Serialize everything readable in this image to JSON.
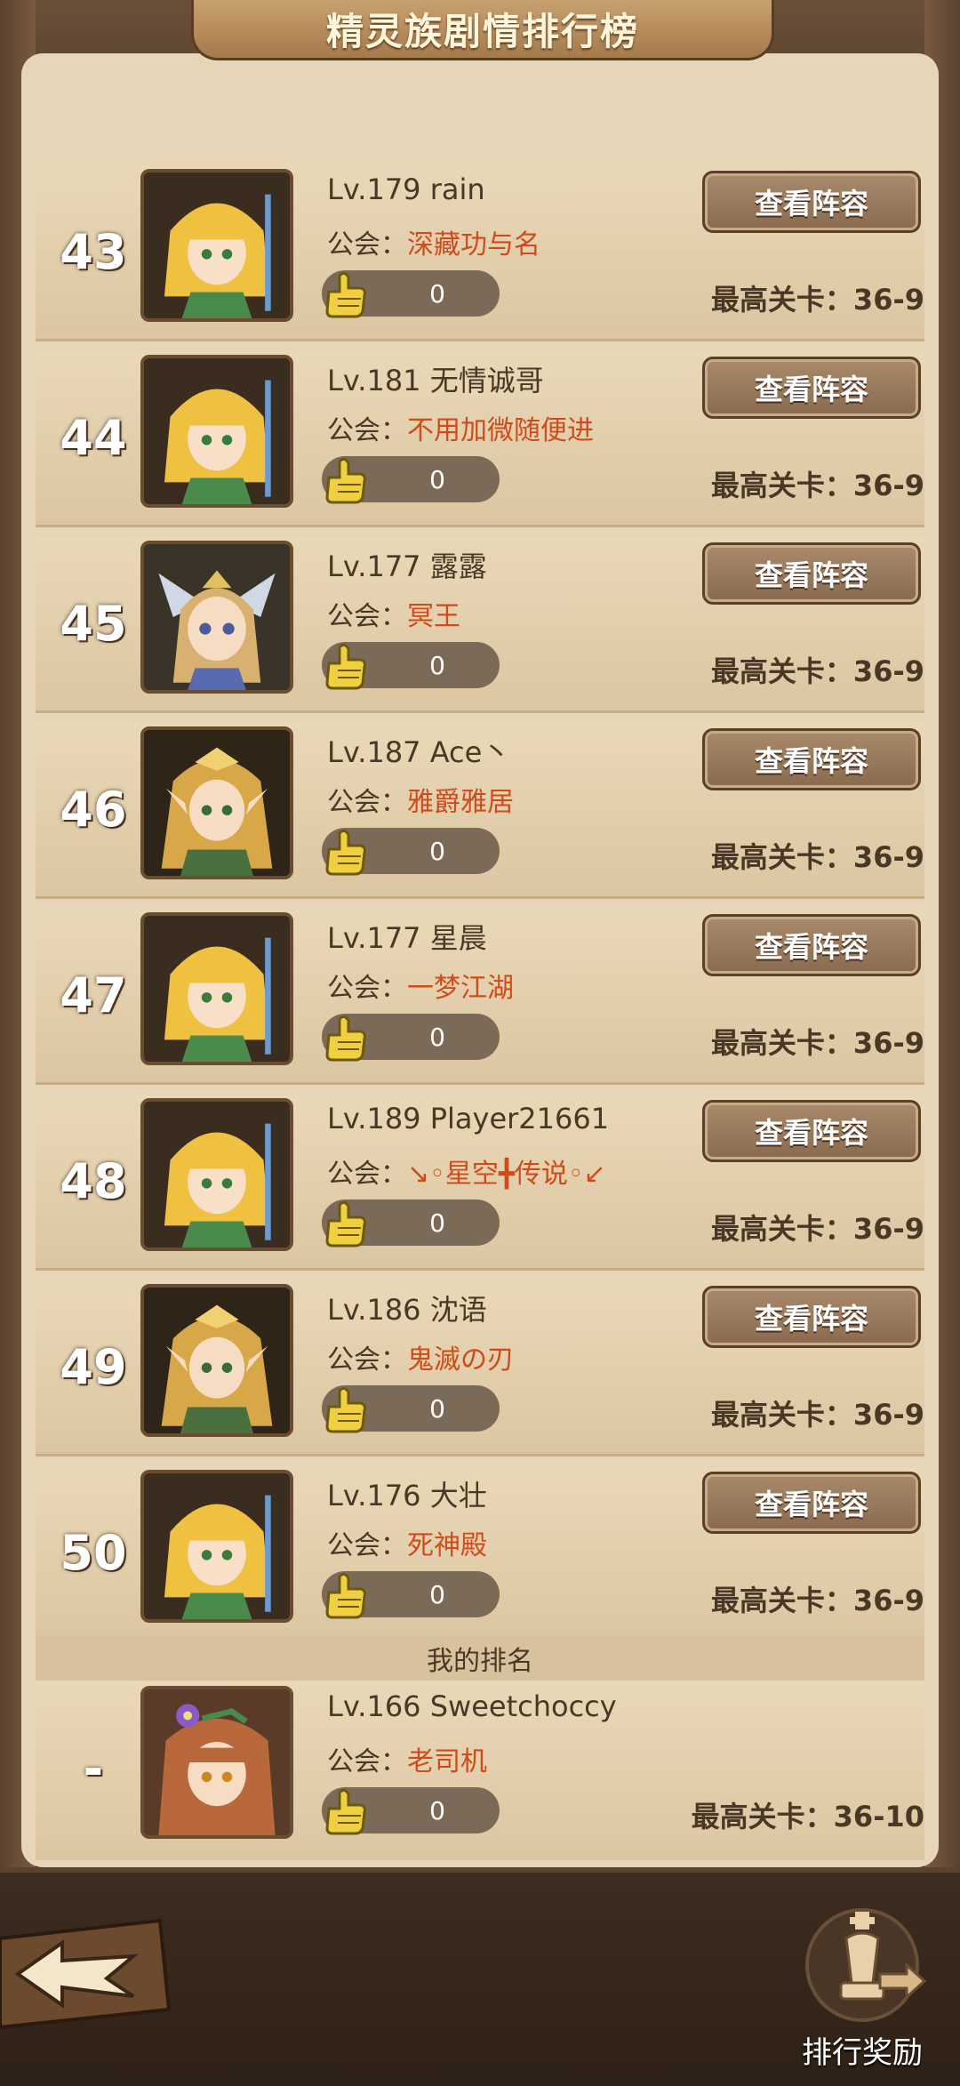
{
  "title": "精灵族剧情排行榜",
  "guild_prefix": "公会：",
  "stage_prefix": "最高关卡：",
  "view_label": "查看阵容",
  "rows": [
    {
      "rank": "43",
      "name": "Lv.179 rain",
      "guild": "深藏功与名",
      "likes": "0",
      "stage": "36-9",
      "avatar": "blonde-mage"
    },
    {
      "rank": "44",
      "name": "Lv.181 无情诚哥",
      "guild": "不用加微随便进",
      "likes": "0",
      "stage": "36-9",
      "avatar": "blonde-mage"
    },
    {
      "rank": "45",
      "name": "Lv.177 露露",
      "guild": "冥王",
      "likes": "0",
      "stage": "36-9",
      "avatar": "winged-knight"
    },
    {
      "rank": "46",
      "name": "Lv.187 Ace丶",
      "guild": "雅爵雅居",
      "likes": "0",
      "stage": "36-9",
      "avatar": "elf-archer"
    },
    {
      "rank": "47",
      "name": "Lv.177 星晨",
      "guild": "一梦江湖",
      "likes": "0",
      "stage": "36-9",
      "avatar": "blonde-mage"
    },
    {
      "rank": "48",
      "name": "Lv.189 Player21661",
      "guild": "↘◦星空╋传说◦↙",
      "likes": "0",
      "stage": "36-9",
      "avatar": "blonde-mage"
    },
    {
      "rank": "49",
      "name": "Lv.186 沈语",
      "guild": "鬼滅の刃",
      "likes": "0",
      "stage": "36-9",
      "avatar": "elf-archer"
    },
    {
      "rank": "50",
      "name": "Lv.176 大壮",
      "guild": "死神殿",
      "likes": "0",
      "stage": "36-9",
      "avatar": "blonde-mage"
    }
  ],
  "my_rank": {
    "label": "我的排名",
    "rank": "-",
    "name": "Lv.166 Sweetchoccy",
    "guild": "老司机",
    "likes": "0",
    "stage": "36-10",
    "avatar": "flower-girl"
  },
  "bottom": {
    "reward_label": "排行奖励"
  },
  "colors": {
    "panel": "#e6d5b6",
    "guild_name": "#cf4b1a",
    "button": "#8a6a4e",
    "frame": "#3a2a1e"
  }
}
